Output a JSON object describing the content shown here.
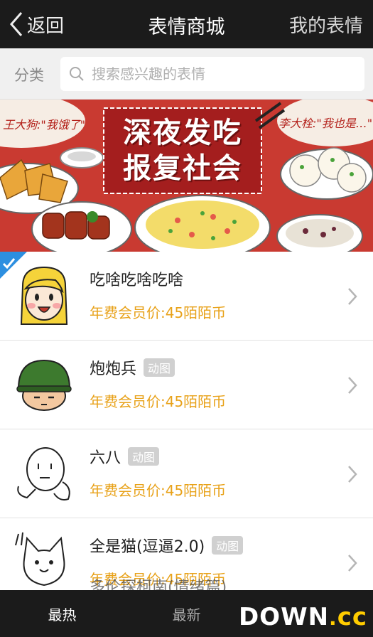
{
  "nav": {
    "back_label": "返回",
    "title": "表情商城",
    "right_label": "我的表情"
  },
  "search": {
    "category_label": "分类",
    "placeholder": "搜索感兴趣的表情"
  },
  "banner": {
    "line1": "深夜发吃",
    "line2": "报复社会",
    "bubble_left": "王大狗:\"我饿了\"",
    "bubble_right": "李大栓:\"我也是…\"",
    "color": "#c93a31"
  },
  "items": [
    {
      "name": "吃啥吃啥吃啥",
      "badge": "",
      "price": "年费会员价:45陌陌币",
      "icon": "blonde-girl-icon",
      "checked": true
    },
    {
      "name": "炮炮兵",
      "badge": "动图",
      "price": "年费会员价:45陌陌币",
      "icon": "soldier-helmet-icon",
      "checked": false
    },
    {
      "name": "六八",
      "badge": "动图",
      "price": "年费会员价:45陌陌币",
      "icon": "doodle-face-icon",
      "checked": false
    },
    {
      "name": "全是猫(逗逼2.0)",
      "badge": "动图",
      "price": "年费会员价:45陌陌币",
      "icon": "cat-doodle-icon",
      "checked": false
    }
  ],
  "partial_item": "多伦探柯南(情绪篇)",
  "tabs": {
    "hot": "最热",
    "new": "最新"
  },
  "watermark": {
    "main": "DOWN",
    "sep": ".",
    "suffix": "cc"
  },
  "colors": {
    "price": "#e8a21a",
    "navbar": "#1b1b1b",
    "check": "#2d8fe0"
  }
}
